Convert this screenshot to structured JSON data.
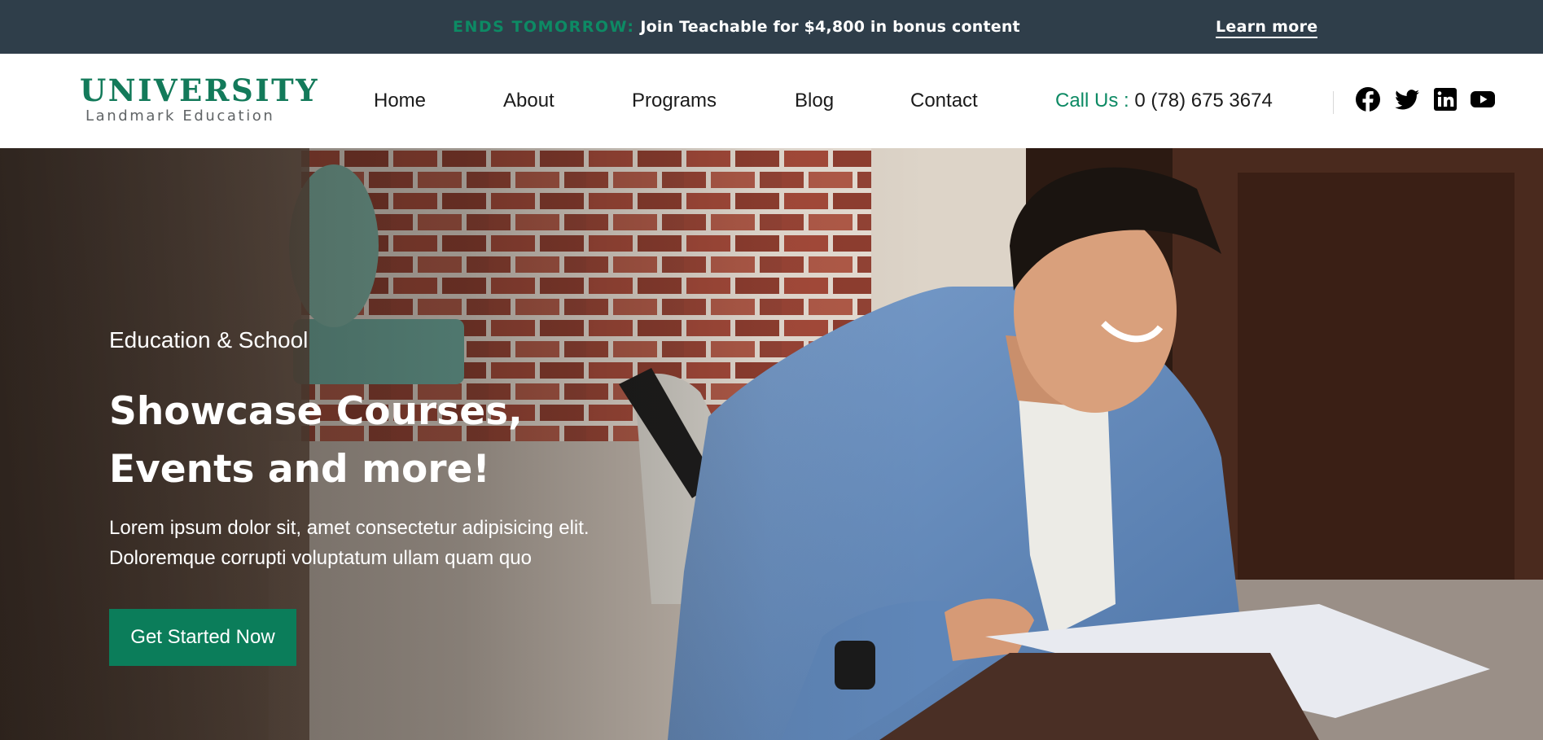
{
  "promo": {
    "highlight": "ENDS TOMORROW:",
    "text": "Join Teachable for $4,800 in bonus content",
    "link_label": "Learn more"
  },
  "header": {
    "logo": {
      "title": "UNIVERSITY",
      "subtitle": "Landmark Education"
    },
    "nav": [
      "Home",
      "About",
      "Programs",
      "Blog",
      "Contact"
    ],
    "call_label": "Call Us :",
    "call_number": "0 (78) 675 3674",
    "social_icons": [
      "facebook-icon",
      "twitter-icon",
      "linkedin-icon",
      "youtube-icon"
    ]
  },
  "hero": {
    "eyebrow": "Education & School",
    "title_lines": [
      "Showcase Courses,",
      "Events and more!"
    ],
    "description_lines": [
      "Lorem ipsum dolor sit, amet consectetur adipisicing elit.",
      "Doloremque corrupti voluptatum ullam quam quo"
    ],
    "cta_label": "Get Started Now"
  },
  "colors": {
    "accent": "#0d8a64",
    "promo_bg": "#2f3e4a",
    "button_bg": "#0b7d5a"
  }
}
